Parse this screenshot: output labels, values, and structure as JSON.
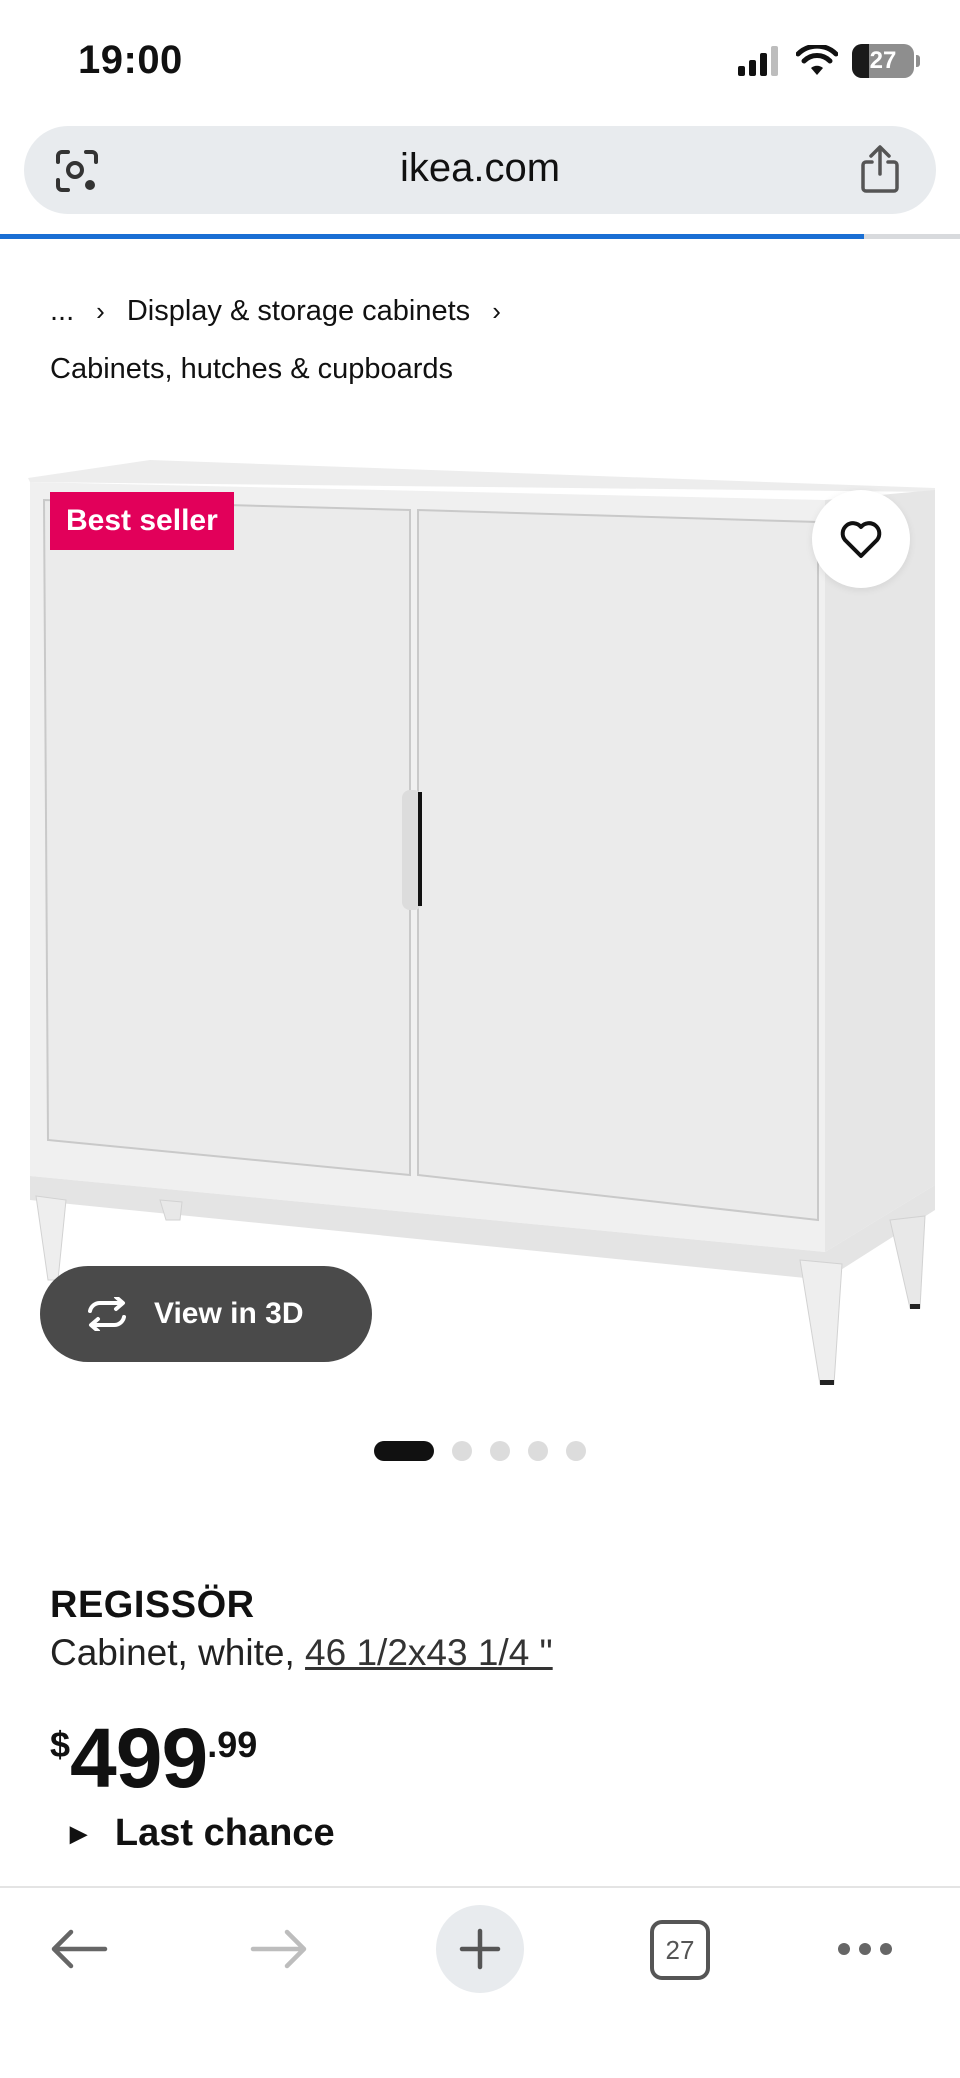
{
  "status_bar": {
    "time": "19:00",
    "battery_level": "27",
    "icons": [
      "signal-icon",
      "wifi-icon",
      "battery-icon"
    ]
  },
  "browser": {
    "url": "ikea.com",
    "load_progress": 0.9,
    "icons": [
      "lens-icon",
      "share-icon"
    ]
  },
  "breadcrumb": {
    "ellipsis": "...",
    "parent": "Display & storage cabinets",
    "current": "Cabinets, hutches & cupboards"
  },
  "product_image": {
    "badge": "Best seller",
    "view_3d_label": "View in 3D",
    "image_count": 5,
    "active_index": 0
  },
  "product": {
    "name": "REGISSÖR",
    "description": "Cabinet, white,",
    "size": "46 1/2x43 1/4 \"",
    "price_currency": "$",
    "price_integer": "499",
    "price_decimal": ".99",
    "availability": "Last chance"
  },
  "toolbar": {
    "tab_count": "27",
    "icons": [
      "back-arrow-icon",
      "forward-arrow-icon",
      "plus-icon",
      "tabs-icon",
      "more-icon"
    ]
  },
  "colors": {
    "badge": "#e2005a",
    "progress": "#1a6fd4",
    "view3d_bg": "#4a4a4a"
  }
}
